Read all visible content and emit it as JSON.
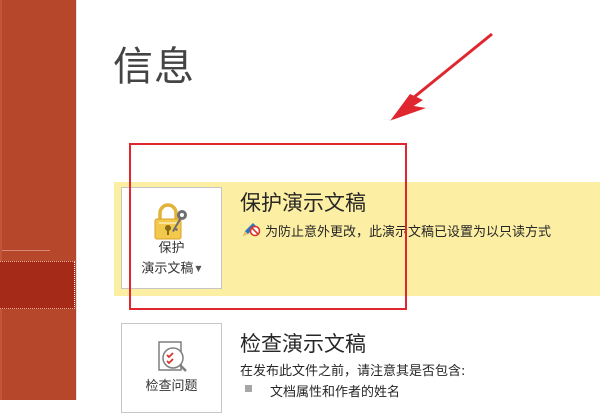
{
  "page": {
    "title": "信息"
  },
  "protect": {
    "button_line1": "保护",
    "button_line2": "演示文稿",
    "heading": "保护演示文稿",
    "status": "为防止意外更改，此演示文稿已设置为以只读方式"
  },
  "inspect": {
    "button_label": "检查问题",
    "heading": "检查演示文稿",
    "desc": "在发布此文件之前，请注意其是否包含:",
    "items": [
      "文档属性和作者的姓名"
    ]
  },
  "colors": {
    "sidebar": "#b7472a",
    "sidebar_selected": "#a52a17",
    "highlight": "#fcefa3",
    "annotation": "#e0262f"
  },
  "icons": {
    "protect": "lock-key-icon",
    "status": "pencil-prohibited-icon",
    "inspect": "document-check-icon"
  }
}
